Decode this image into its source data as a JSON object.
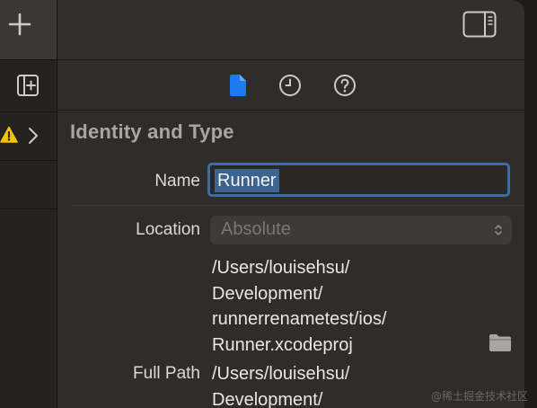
{
  "toolbar": {
    "add_icon": "plus-icon",
    "add_editor_icon": "add-editor-icon"
  },
  "navigator": {
    "warning_icon": "warning-icon",
    "disclosure_icon": "chevron-right-icon"
  },
  "inspector": {
    "top_icon": "sidebar-toggle-icon",
    "tabs": [
      {
        "name": "file-inspector",
        "icon": "file-icon",
        "selected": true
      },
      {
        "name": "history-inspector",
        "icon": "clock-icon",
        "selected": false
      },
      {
        "name": "quick-help-inspector",
        "icon": "question-icon",
        "selected": false
      }
    ],
    "section_title": "Identity and Type",
    "name_label": "Name",
    "name_value": "Runner",
    "location_label": "Location",
    "location_value": "Absolute",
    "location_path": [
      "/Users/louisehsu/",
      "Development/",
      "runnerrenametest/ios/",
      "Runner.xcodeproj"
    ],
    "full_path_label": "Full Path",
    "full_path": [
      "/Users/louisehsu/",
      "Development/"
    ]
  },
  "watermark": "@稀土掘金技术社区",
  "colors": {
    "accent": "#1a7cf5",
    "warning": "#f5c400",
    "selection": "#3d648f",
    "focus_ring": "#3b6ea5"
  }
}
